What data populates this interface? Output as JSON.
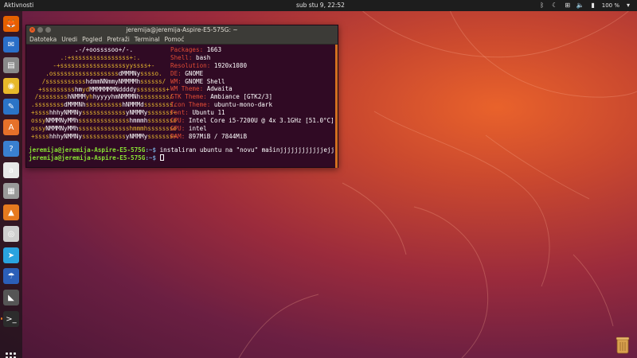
{
  "topbar": {
    "activities": "Aktivnosti",
    "clock": "sub stu  9, 22:52",
    "battery": "100 %"
  },
  "terminal": {
    "title": "jeremija@jeremija-Aspire-E5-575G: ~",
    "menu": [
      "Datoteka",
      "Uredi",
      "Pogled",
      "Pretraži",
      "Terminal",
      "Pomoć"
    ],
    "info": [
      {
        "key": "Packages:",
        "value": "1663"
      },
      {
        "key": "Shell:",
        "value": "bash"
      },
      {
        "key": "Resolution:",
        "value": "1920x1080"
      },
      {
        "key": "DE:",
        "value": "GNOME"
      },
      {
        "key": "WM:",
        "value": "GNOME Shell"
      },
      {
        "key": "WM Theme:",
        "value": "Adwaita"
      },
      {
        "key": "GTK Theme:",
        "value": "Ambiance [GTK2/3]"
      },
      {
        "key": "Icon Theme:",
        "value": "ubuntu-mono-dark"
      },
      {
        "key": "Font:",
        "value": "Ubuntu 11"
      },
      {
        "key": "CPU:",
        "value": "Intel Core i5-7200U @ 4x 3.1GHz [51.0°C]"
      },
      {
        "key": "GPU:",
        "value": "intel"
      },
      {
        "key": "RAM:",
        "value": "897MiB / 7844MiB"
      }
    ],
    "prompt_user": "jeremija@jeremija-Aspire-E5-575G",
    "prompt_path": ":~$",
    "command1": " instaliran ubuntu na \"novu\" mašinjjjjjjjjjjjjejj",
    "command2": " "
  },
  "dock": {
    "items": [
      {
        "name": "firefox-icon",
        "glyph": "🦊",
        "color": "#e66000",
        "active": false
      },
      {
        "name": "thunderbird-icon",
        "glyph": "✉",
        "color": "#2a6fc9",
        "active": false
      },
      {
        "name": "files-icon",
        "glyph": "▤",
        "color": "#8a8a8a",
        "active": false
      },
      {
        "name": "rhythmbox-icon",
        "glyph": "◉",
        "color": "#e8b92a",
        "active": false
      },
      {
        "name": "writer-icon",
        "glyph": "✎",
        "color": "#2b74c7",
        "active": false
      },
      {
        "name": "software-center-icon",
        "glyph": "A",
        "color": "#e6712a",
        "active": false
      },
      {
        "name": "help-icon",
        "glyph": "?",
        "color": "#3a80d0",
        "active": false
      },
      {
        "name": "amazon-icon",
        "glyph": "a",
        "color": "#e8e8e8",
        "active": false
      },
      {
        "name": "synaptic-icon",
        "glyph": "▦",
        "color": "#9a9a9a",
        "active": false
      },
      {
        "name": "vlc-icon",
        "glyph": "▲",
        "color": "#e67a1f",
        "active": false
      },
      {
        "name": "disk-icon",
        "glyph": "◎",
        "color": "#cfcfcf",
        "active": false
      },
      {
        "name": "telegram-icon",
        "glyph": "➤",
        "color": "#2aa3e0",
        "active": false
      },
      {
        "name": "hotspot-icon",
        "glyph": "☂",
        "color": "#2b5fb8",
        "active": false
      },
      {
        "name": "screenshot-icon",
        "glyph": "◣",
        "color": "#555555",
        "active": false
      },
      {
        "name": "terminal-icon",
        "glyph": ">_",
        "color": "#2c2c2c",
        "active": true
      }
    ]
  }
}
